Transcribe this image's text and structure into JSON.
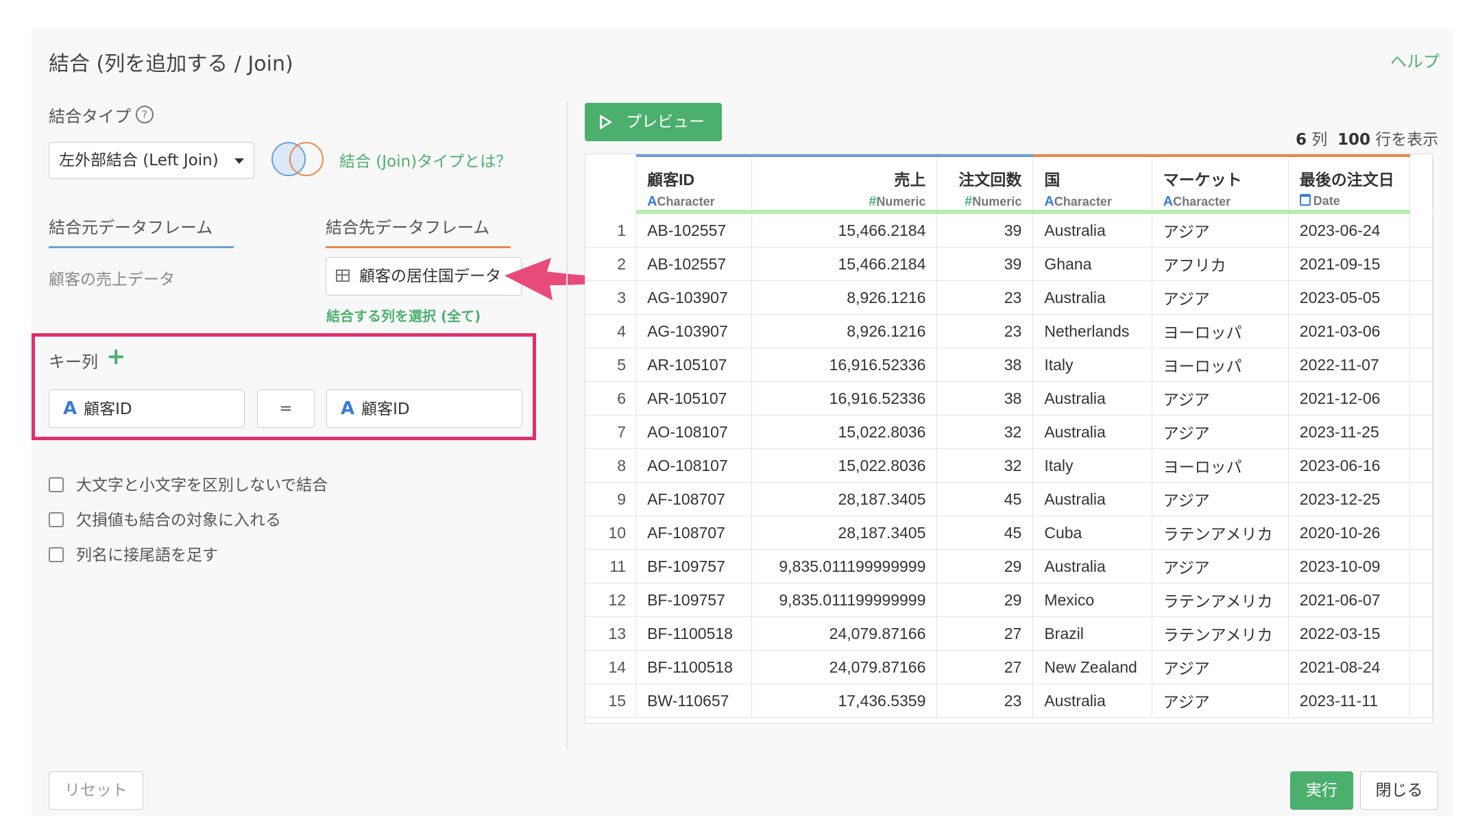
{
  "dialog": {
    "title": "結合 (列を追加する / Join)",
    "help_label": "ヘルプ"
  },
  "join_type": {
    "label": "結合タイプ",
    "selected": "左外部結合 (Left Join)",
    "link": "結合 (Join)タイプとは？"
  },
  "frames": {
    "source_tab": "結合元データフレーム",
    "target_tab": "結合先データフレーム",
    "source_name": "顧客の売上データ",
    "target_name": "顧客の居住国データ",
    "select_columns": "結合する列を選択 (全て)"
  },
  "key_columns": {
    "label": "キー列",
    "left": "顧客ID",
    "operator": "=",
    "right": "顧客ID",
    "type_icon": "A"
  },
  "options": [
    "大文字と小文字を区別しないで結合",
    "欠損値も結合の対象に入れる",
    "列名に接尾語を足す"
  ],
  "preview": {
    "button": "プレビュー",
    "col_count": "6",
    "col_unit": "列",
    "row_count": "100",
    "row_unit": "行を表示"
  },
  "table": {
    "columns": [
      {
        "name": "顧客ID",
        "type_icon": "A",
        "type": "Character"
      },
      {
        "name": "売上",
        "type_icon": "#",
        "type": "Numeric"
      },
      {
        "name": "注文回数",
        "type_icon": "#",
        "type": "Numeric"
      },
      {
        "name": "国",
        "type_icon": "A",
        "type": "Character"
      },
      {
        "name": "マーケット",
        "type_icon": "A",
        "type": "Character"
      },
      {
        "name": "最後の注文日",
        "type_icon": "calendar-icon",
        "type": "Date"
      }
    ],
    "rows": [
      [
        "1",
        "AB-102557",
        "15,466.2184",
        "39",
        "Australia",
        "アジア",
        "2023-06-24"
      ],
      [
        "2",
        "AB-102557",
        "15,466.2184",
        "39",
        "Ghana",
        "アフリカ",
        "2021-09-15"
      ],
      [
        "3",
        "AG-103907",
        "8,926.1216",
        "23",
        "Australia",
        "アジア",
        "2023-05-05"
      ],
      [
        "4",
        "AG-103907",
        "8,926.1216",
        "23",
        "Netherlands",
        "ヨーロッパ",
        "2021-03-06"
      ],
      [
        "5",
        "AR-105107",
        "16,916.52336",
        "38",
        "Italy",
        "ヨーロッパ",
        "2022-11-07"
      ],
      [
        "6",
        "AR-105107",
        "16,916.52336",
        "38",
        "Australia",
        "アジア",
        "2021-12-06"
      ],
      [
        "7",
        "AO-108107",
        "15,022.8036",
        "32",
        "Australia",
        "アジア",
        "2023-11-25"
      ],
      [
        "8",
        "AO-108107",
        "15,022.8036",
        "32",
        "Italy",
        "ヨーロッパ",
        "2023-06-16"
      ],
      [
        "9",
        "AF-108707",
        "28,187.3405",
        "45",
        "Australia",
        "アジア",
        "2023-12-25"
      ],
      [
        "10",
        "AF-108707",
        "28,187.3405",
        "45",
        "Cuba",
        "ラテンアメリカ",
        "2020-10-26"
      ],
      [
        "11",
        "BF-109757",
        "9,835.011199999999",
        "29",
        "Australia",
        "アジア",
        "2023-10-09"
      ],
      [
        "12",
        "BF-109757",
        "9,835.011199999999",
        "29",
        "Mexico",
        "ラテンアメリカ",
        "2021-06-07"
      ],
      [
        "13",
        "BF-1100518",
        "24,079.87166",
        "27",
        "Brazil",
        "ラテンアメリカ",
        "2022-03-15"
      ],
      [
        "14",
        "BF-1100518",
        "24,079.87166",
        "27",
        "New Zealand",
        "アジア",
        "2021-08-24"
      ],
      [
        "15",
        "BW-110657",
        "17,436.5359",
        "23",
        "Australia",
        "アジア",
        "2023-11-11"
      ]
    ]
  },
  "footer": {
    "reset": "リセット",
    "run": "実行",
    "close": "閉じる"
  },
  "colors": {
    "accent_green": "#4caf6e",
    "highlight_pink": "#e0306a",
    "source_blue": "#6a9fd8",
    "target_orange": "#e8894a"
  }
}
